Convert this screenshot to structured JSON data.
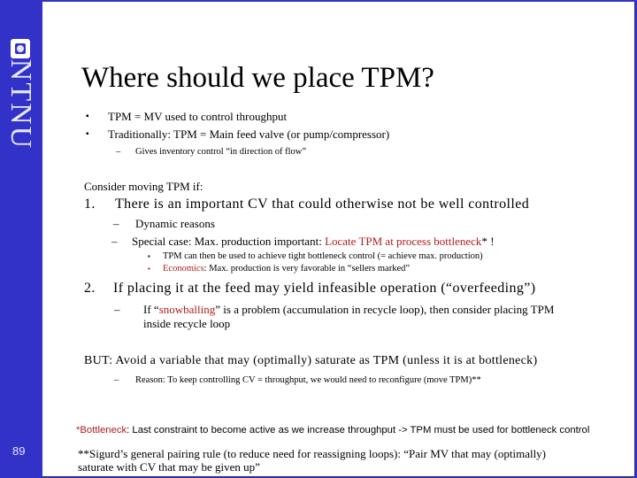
{
  "sidebar": {
    "logo_text": "NTNU",
    "page_number": "89",
    "color": "#3232c8"
  },
  "slide": {
    "title": "Where should we place TPM?",
    "top_bullets": [
      {
        "marker": "▪",
        "text": "TPM = MV used to control throughput"
      },
      {
        "marker": "▪",
        "text": "Traditionally: TPM = Main feed valve (or pump/compressor)"
      }
    ],
    "top_sub": {
      "marker": "–",
      "text": "Gives inventory control “in direction of flow”"
    },
    "consider_heading": "Consider moving TPM if:",
    "item1": {
      "number": "1.",
      "text": "There is an important CV that could otherwise not be well controlled",
      "subs": [
        {
          "marker": "–",
          "text": "Dynamic reasons"
        },
        {
          "marker": "–",
          "text": "Special case: Max. production important: ",
          "red_text": "Locate TPM at process bottleneck",
          "suffix": "* !"
        }
      ],
      "subsubs": [
        {
          "marker": "▪",
          "text": "TPM can then be used to achieve tight bottleneck control (= achieve max. production)"
        },
        {
          "marker": "▪",
          "red_text": "Economics",
          "text": ": Max. production is very favorable in “sellers marked”"
        }
      ]
    },
    "item2": {
      "number": "2.",
      "text": "If placing it at the feed may yield infeasible operation (“overfeeding”)",
      "sub": {
        "marker": "–",
        "prefix": "If “",
        "red_text": "snowballing",
        "line1_rest": "” is a problem (accumulation in recycle loop), then consider placing TPM",
        "line2": "inside recycle loop"
      }
    },
    "but": {
      "text": "BUT: Avoid a variable that may (optimally) saturate as TPM (unless it is at bottleneck)",
      "sub": {
        "marker": "–",
        "text": "Reason: To keep controlling CV = throughput, we would need to reconfigure (move TPM)**"
      }
    },
    "footnote1": {
      "red_text": "*Bottleneck",
      "text": ": Last constraint to become active as we increase throughput -> TPM must be used for bottleneck control"
    },
    "footnote2": {
      "line1": "**Sigurd’s general pairing rule (to reduce need for reassigning loops): “Pair MV that may (optimally)",
      "line2": "saturate with CV that may be given up”"
    },
    "accent_red": "#b01c1c"
  }
}
